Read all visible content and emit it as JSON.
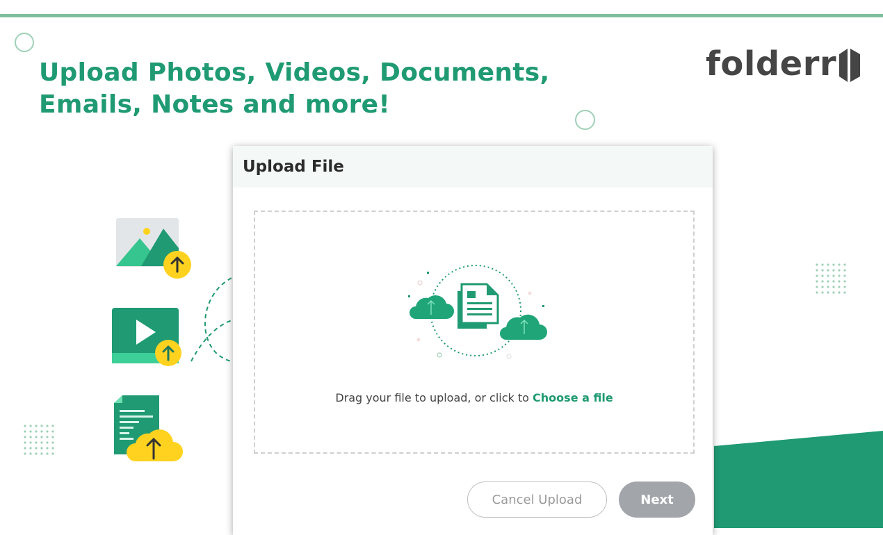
{
  "headline": {
    "line1": "Upload Photos, Videos, Documents,",
    "line2": "Emails, Notes and more!"
  },
  "logo": {
    "text": "folderr",
    "mark_icon": "folderr-logo-mark-icon"
  },
  "dialog": {
    "title": "Upload File",
    "drop_text": "Drag your file to upload, or click to",
    "choose_link": "Choose a file",
    "cancel_label": "Cancel Upload",
    "next_label": "Next"
  },
  "icons": [
    "image-upload-icon",
    "video-upload-icon",
    "document-upload-icon",
    "cloud-upload-icon",
    "document-icon",
    "upload-arrow-icon"
  ],
  "colors": {
    "brand_green": "#1f9a72",
    "accent_yellow": "#ffd21f",
    "logo_gray": "#454545",
    "next_button": "#a2a6ab",
    "header_bg": "#f4f9f7"
  }
}
